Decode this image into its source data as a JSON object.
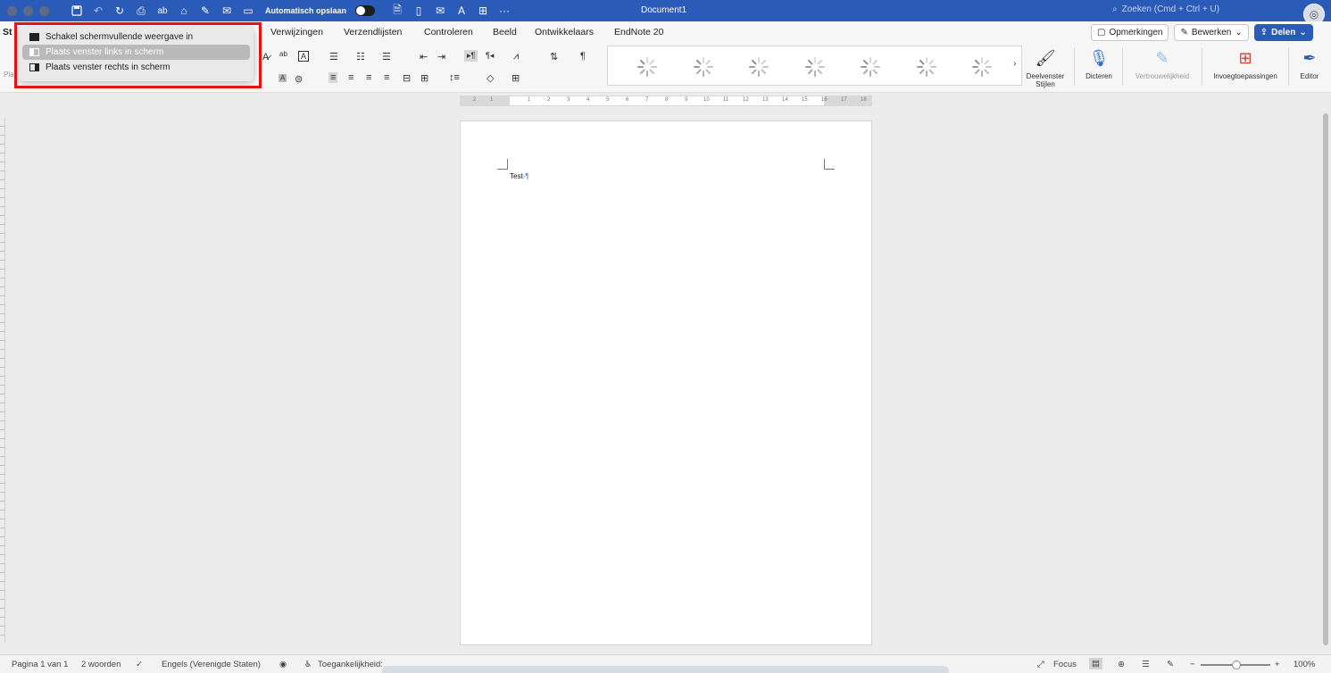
{
  "titlebar": {
    "autosave_label": "Automatisch opslaan",
    "document_title": "Document1",
    "search_placeholder": "Zoeken (Cmd + Ctrl + U)",
    "quick_access_icons": [
      "save-icon",
      "undo-icon",
      "redo-icon",
      "print-icon",
      "spelling-icon",
      "home-icon",
      "pen-icon",
      "mail-icon",
      "present-icon"
    ],
    "more_label": "···"
  },
  "tabs": {
    "active_partial": "St",
    "items": [
      "Verwijzingen",
      "Verzendlijsten",
      "Controleren",
      "Beeld",
      "Ontwikkelaars",
      "EndNote 20"
    ]
  },
  "header_buttons": {
    "comments": "Opmerkingen",
    "edit": "Bewerken",
    "share": "Delen"
  },
  "ribbon": {
    "paste_partial": "Pla",
    "styles_pane": "Deelvenster Stijlen",
    "dictate": "Dicteren",
    "sensitivity": "Vertrouwelijkheid",
    "addins": "Invoegtoepassingen",
    "editor": "Editor",
    "pilcrow_symbol": "¶"
  },
  "ruler": {
    "numbers": [
      "2",
      "1",
      "1",
      "2",
      "3",
      "4",
      "5",
      "6",
      "7",
      "8",
      "9",
      "10",
      "11",
      "12",
      "13",
      "14",
      "15",
      "16",
      "17",
      "18"
    ]
  },
  "document": {
    "text": "Test",
    "tab_mark": "›",
    "pilcrow": "¶"
  },
  "menu": {
    "items": [
      {
        "label": "Schakel schermvullende weergave in",
        "icon": "fullscreen-icon",
        "selected": false
      },
      {
        "label": "Plaats venster links in scherm",
        "icon": "tile-left-icon",
        "selected": true
      },
      {
        "label": "Plaats venster rechts in scherm",
        "icon": "tile-right-icon",
        "selected": false
      }
    ]
  },
  "statusbar": {
    "page": "Pagina 1 van 1",
    "words": "2 woorden",
    "language": "Engels (Verenigde Staten)",
    "accessibility": "Toegankelijkheid: alles in orde",
    "focus": "Focus",
    "zoom": "100%",
    "zoom_minus": "−",
    "zoom_plus": "+"
  },
  "colors": {
    "titlebar": "#2b5bb8",
    "highlight": "#e01414",
    "pilcrow": "#3d7bd9"
  }
}
